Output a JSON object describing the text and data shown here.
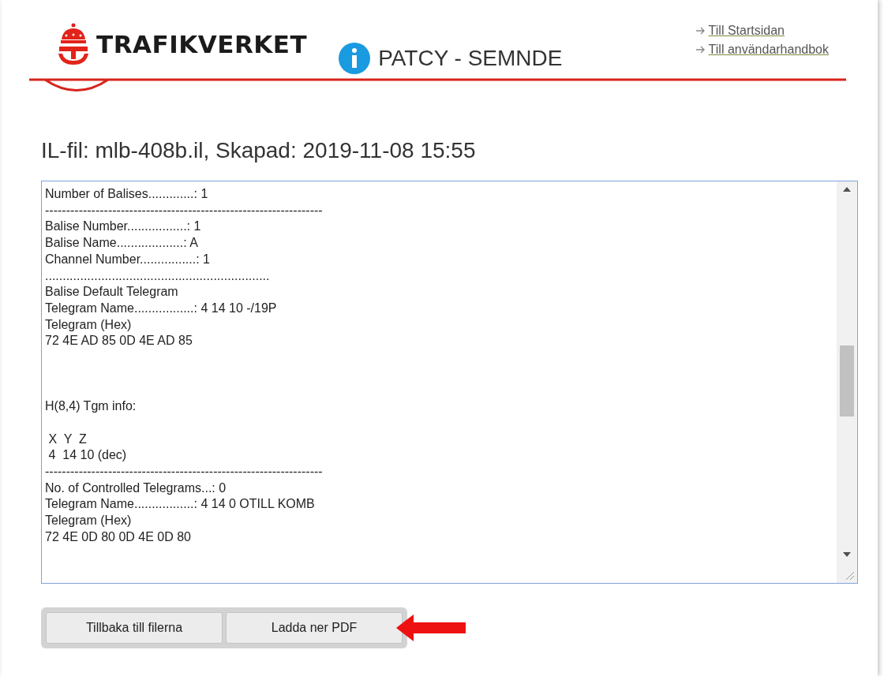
{
  "header": {
    "brand": "TRAFIKVERKET",
    "app_title": "PATCY - SEMNDE",
    "links": [
      {
        "label": "Till Startsidan"
      },
      {
        "label": "Till användarhandbok"
      }
    ]
  },
  "page_title": "IL-fil: mlb-408b.il, Skapad: 2019-11-08 15:55",
  "file_content": "Number of Balises.............: 1\n------------------------------------------------------------------\nBalise Number.................: 1\nBalise Name...................: A\nChannel Number................: 1\n................................................................\nBalise Default Telegram\nTelegram Name.................: 4 14 10 -/19P\nTelegram (Hex)\n72 4E AD 85 0D 4E AD 85\n\n\n\nH(8,4) Tgm info:\n\n X  Y  Z\n 4  14 10 (dec)\n------------------------------------------------------------------\nNo. of Controlled Telegrams...: 0\nTelegram Name.................: 4 14 0 OTILL KOMB\nTelegram (Hex)\n72 4E 0D 80 0D 4E 0D 80",
  "buttons": [
    {
      "label": "Tillbaka till filerna"
    },
    {
      "label": "Ladda ner PDF"
    }
  ]
}
